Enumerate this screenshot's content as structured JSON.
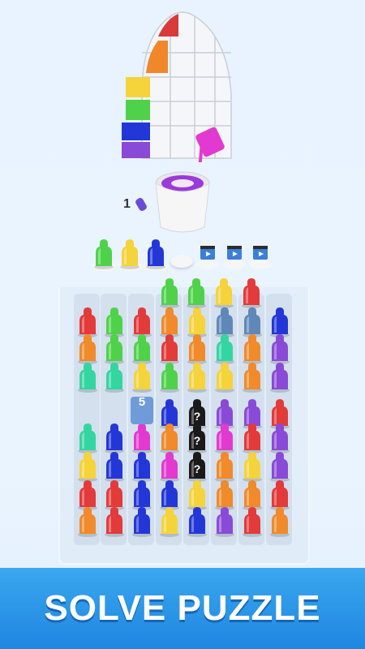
{
  "banner": {
    "title": "SOLVE PUZZLE"
  },
  "bottle_counter": "1",
  "locked_slot_label": "5",
  "hidden_label": "?",
  "colors": {
    "red": "#e33a3a",
    "orange": "#f08a2a",
    "yellow": "#f5d33a",
    "green": "#4fd24a",
    "teal": "#33d6a0",
    "blue": "#2337d8",
    "purple": "#8a4ad8",
    "magenta": "#e23ad0",
    "black": "#1a1a1a",
    "slate": "#5f88b8",
    "white": "#f5f6f8"
  },
  "tray": [
    "green",
    "yellow",
    "blue",
    "white",
    "video",
    "video",
    "video"
  ],
  "queue": [
    "green",
    "green",
    "yellow",
    "red"
  ],
  "columns": [
    [
      "red",
      "orange",
      "teal",
      "empty",
      "teal",
      "yellow",
      "red",
      "orange"
    ],
    [
      "green",
      "green",
      "teal",
      "empty",
      "blue",
      "blue",
      "red",
      "red"
    ],
    [
      "red",
      "green",
      "yellow",
      "empty",
      "magenta",
      "blue",
      "blue",
      "blue"
    ],
    [
      "orange",
      "red",
      "green",
      "blue",
      "orange",
      "magenta",
      "blue",
      "yellow"
    ],
    [
      "yellow",
      "orange",
      "yellow",
      "hidden",
      "hidden",
      "hidden",
      "yellow",
      "blue"
    ],
    [
      "slate",
      "teal",
      "yellow",
      "purple",
      "magenta",
      "orange",
      "orange",
      "purple"
    ],
    [
      "slate",
      "orange",
      "orange",
      "purple",
      "red",
      "yellow",
      "orange",
      "red"
    ],
    [
      "blue",
      "purple",
      "purple",
      "red",
      "purple",
      "purple",
      "red",
      "orange"
    ]
  ]
}
